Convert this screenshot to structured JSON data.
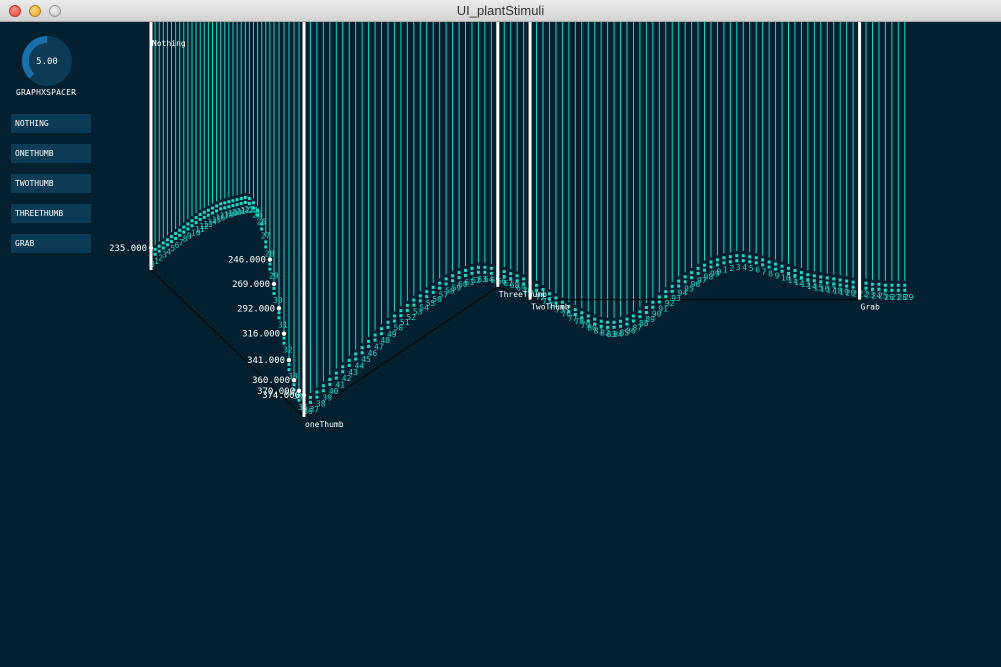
{
  "window": {
    "title": "UI_plantStimuli"
  },
  "knob": {
    "value": 5.0,
    "display": "5.00",
    "min": 0,
    "max": 10,
    "label": "GRAPHXSPACER"
  },
  "buttons": [
    {
      "label": "NOTHING"
    },
    {
      "label": "ONETHUMB"
    },
    {
      "label": "TWOTHUMB"
    },
    {
      "label": "THREETHUMB"
    },
    {
      "label": "GRAB"
    }
  ],
  "colors": {
    "background": "#02202f",
    "accent": "#1fd6c4",
    "control": "#0b3b55",
    "knob_active": "#1b6fa8",
    "marker": "#ffffff"
  },
  "markers": [
    {
      "label": "Nothing"
    },
    {
      "label": "oneThumb"
    },
    {
      "label": "ThreeThumb"
    },
    {
      "label": "TwoThumb"
    },
    {
      "label": "Grab"
    }
  ],
  "value_labels": [
    "235.000",
    "246.000",
    "269.000",
    "292.000",
    "316.000",
    "341.000",
    "360.000",
    "370.000",
    "374.000"
  ],
  "chart_data": {
    "type": "line",
    "series": [
      {
        "values": [
          235,
          232,
          229,
          226,
          223,
          220,
          217,
          214,
          211,
          208,
          205,
          202,
          199,
          197,
          195,
          193,
          191,
          189,
          188,
          187,
          186,
          185,
          184,
          183,
          184,
          188,
          195,
          208,
          225,
          246,
          269,
          292,
          316,
          341,
          360,
          370,
          374,
          372,
          367,
          361,
          355,
          349,
          343,
          337,
          331,
          325,
          319,
          313,
          307,
          301,
          295,
          290,
          285,
          280,
          276,
          272,
          268,
          264,
          260,
          257,
          254,
          252,
          250,
          249,
          249,
          250,
          251,
          253,
          255,
          257,
          260,
          263,
          266,
          270,
          274,
          278,
          282,
          286,
          289,
          292,
          295,
          298,
          300,
          301,
          301,
          300,
          298,
          295,
          291,
          287,
          282,
          277,
          272,
          267,
          262,
          258,
          254,
          250,
          247,
          244,
          242,
          240,
          239,
          238,
          238,
          239,
          240,
          242,
          244,
          246,
          248,
          250,
          252,
          254,
          256,
          257,
          258,
          259,
          260,
          261,
          262,
          263,
          263,
          264,
          265,
          265,
          266,
          266,
          266,
          266
        ]
      }
    ],
    "marker_indices": [
      0,
      36,
      66,
      71,
      122
    ]
  }
}
